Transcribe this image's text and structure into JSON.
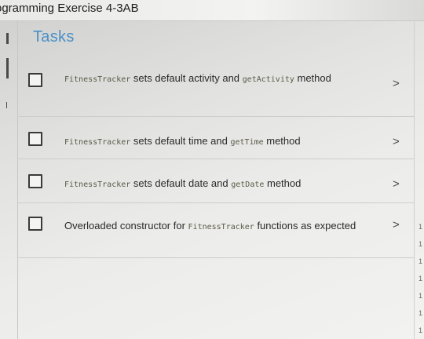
{
  "window": {
    "title": "ogramming Exercise 4-3AB"
  },
  "panel": {
    "title": "Tasks"
  },
  "tasks": [
    {
      "parts": [
        {
          "text": "FitnessTracker",
          "code": true
        },
        {
          "text": " sets default activity and ",
          "code": false
        },
        {
          "text": "getActivity",
          "code": true
        },
        {
          "text": " method",
          "code": false
        }
      ]
    },
    {
      "parts": [
        {
          "text": "FitnessTracker",
          "code": true
        },
        {
          "text": " sets default time and ",
          "code": false
        },
        {
          "text": "getTime",
          "code": true
        },
        {
          "text": " method",
          "code": false
        }
      ]
    },
    {
      "parts": [
        {
          "text": "FitnessTracker",
          "code": true
        },
        {
          "text": " sets default date and ",
          "code": false
        },
        {
          "text": "getDate",
          "code": true
        },
        {
          "text": " method",
          "code": false
        }
      ]
    },
    {
      "parts": [
        {
          "text": "Overloaded constructor for ",
          "code": false
        },
        {
          "text": "FitnessTracker",
          "code": true
        },
        {
          "text": " functions as expected",
          "code": false
        }
      ]
    }
  ],
  "chevron_glyph": ">",
  "right_rail_numbers": [
    "1",
    "1",
    "1",
    "1",
    "1",
    "1",
    "1",
    "1"
  ]
}
